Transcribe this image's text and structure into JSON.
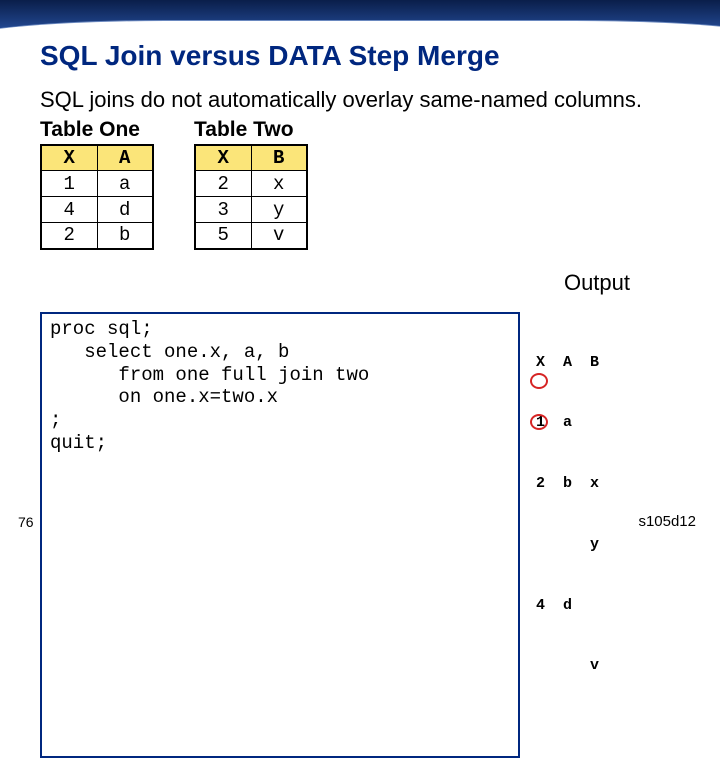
{
  "title": "SQL Join versus DATA Step Merge",
  "description": "SQL joins do not automatically overlay same-named columns.",
  "table_one": {
    "title": "Table One",
    "cols": [
      "X",
      "A"
    ],
    "rows": [
      [
        "1",
        "a"
      ],
      [
        "4",
        "d"
      ],
      [
        "2",
        "b"
      ]
    ]
  },
  "table_two": {
    "title": "Table Two",
    "cols": [
      "X",
      "B"
    ],
    "rows": [
      [
        "2",
        "x"
      ],
      [
        "3",
        "y"
      ],
      [
        "5",
        "v"
      ]
    ]
  },
  "output_label": "Output",
  "code": "proc sql;\n   select one.x, a, b\n      from one full join two\n      on one.x=two.x\n;\nquit;",
  "output_table": {
    "header": "X  A  B",
    "rows": [
      "1  a",
      "2  b  x",
      "      y",
      "4  d",
      "      v"
    ]
  },
  "page_number": "76",
  "footer_id": "s105d12"
}
